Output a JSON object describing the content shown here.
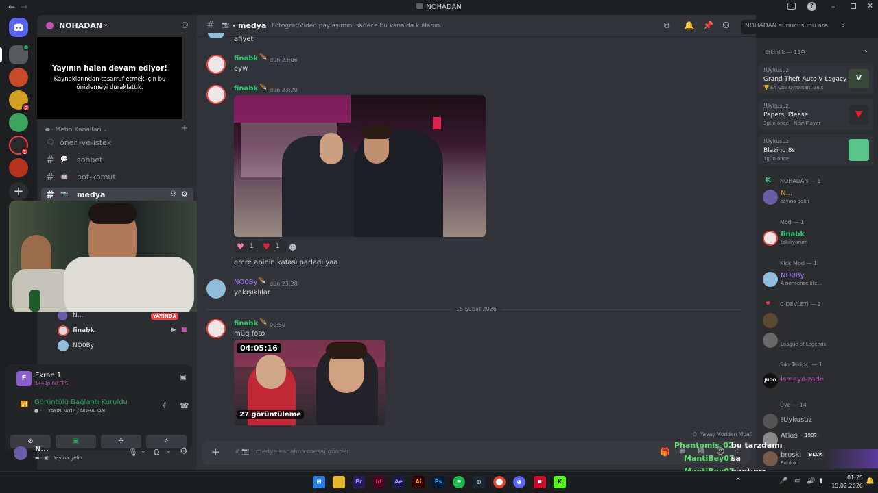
{
  "window": {
    "title": "NOHADAN"
  },
  "server": {
    "name": "NOHADAN",
    "badges": [
      "2",
      "1"
    ]
  },
  "stream_notice": {
    "title": "Yayının halen devam ediyor!",
    "body": "Kaynaklarından tasarruf etmek için bu önizlemeyi duraklattık."
  },
  "category": {
    "label": "Metin Kanalları"
  },
  "channels": [
    {
      "name": "öneri-ve-istek"
    },
    {
      "name": "sohbet"
    },
    {
      "name": "bot-komut"
    },
    {
      "name": "medya"
    }
  ],
  "voice_users": [
    {
      "name": "N...",
      "badge": "YAYINDA"
    },
    {
      "name": "finabk"
    },
    {
      "name": "NO0By"
    }
  ],
  "screen_panel": {
    "title": "Ekran 1",
    "sub": "1440p 60 FPS",
    "status": "Görüntülü Bağlantı Kuruldu",
    "channel": "YAYINDAYIZ / NOHADAN"
  },
  "user": {
    "name": "N...",
    "status": "Yayına gelin"
  },
  "chat_header": {
    "channel": "medya",
    "topic": "Fotoğraf/Video paylaşımını sadece bu kanalda kullanın.",
    "search_placeholder": "NOHADAN sunucusunu ara"
  },
  "messages": {
    "m0": {
      "text": "afiyet"
    },
    "m1": {
      "user": "finabk",
      "time": "dün 23:06",
      "text": "eyw"
    },
    "m2": {
      "user": "finabk",
      "time": "dün 23:20"
    },
    "reactions": [
      {
        "emoji": "♥",
        "count": "1"
      },
      {
        "emoji": "♥",
        "count": "1"
      }
    ],
    "m3": {
      "text": "emre abinin kafası parladı yaa"
    },
    "m4": {
      "user": "NO0By",
      "time": "dün 23:28",
      "text": "yakışıklılar"
    },
    "divider": "15 Şubat 2026",
    "m5": {
      "user": "finabk",
      "time": "00:50",
      "text": "müq foto",
      "video_time": "04:05:16",
      "video_views": "27 görüntüleme"
    }
  },
  "slowmode": "Yavaş Moddan Muaf",
  "composer": {
    "placeholder": "medya kanalına mesaj gönder"
  },
  "overlay_chat": [
    {
      "user": "Phantomis_02",
      "msg": "bu tarzdamı"
    },
    {
      "user": "MantiBey07",
      "msg": "sa"
    },
    {
      "user": "MantiBey07",
      "msg": "naptınız"
    }
  ],
  "activity": {
    "header": "Etkinlik — 15",
    "cards": [
      {
        "user": "!Uykusuz",
        "game": "Grand Theft Auto V Legacy",
        "meta": "En Çok Oynanan: 28 s"
      },
      {
        "user": "!Uykusuz",
        "game": "Papers, Please",
        "meta": "3gün önce",
        "meta2": "New Player"
      },
      {
        "user": "!Uykusuz",
        "game": "Blazing 8s",
        "meta": "1gün önce"
      }
    ]
  },
  "member_groups": [
    {
      "label": "NOHADAN — 1",
      "members": [
        {
          "name": "N...",
          "status": "Yayına gelin"
        }
      ]
    },
    {
      "label": "Mod — 1",
      "members": [
        {
          "name": "finabk",
          "status": "takılıyorum"
        }
      ]
    },
    {
      "label": "Kick Mod — 1",
      "members": [
        {
          "name": "NO0By",
          "status": "A nonsense life..."
        }
      ]
    },
    {
      "label": "C-DEVLETİ — 2",
      "members": [
        {
          "name": "...",
          "status": ""
        },
        {
          "name": ".",
          "status": "League of Legends"
        }
      ]
    },
    {
      "label": "Sıkı Takipçi — 1",
      "members": [
        {
          "name": "İsmayıl-zade",
          "status": ""
        }
      ]
    },
    {
      "label": "Üye — 14",
      "members": [
        {
          "name": "!Uykusuz",
          "status": ""
        },
        {
          "name": "Atlas",
          "status": "",
          "tag": "1907"
        },
        {
          "name": "broski",
          "status": "Roblox",
          "tag": "BLCK"
        }
      ]
    }
  ],
  "clock": {
    "time": "01:25",
    "date": "15.02.2026"
  },
  "colors": {
    "accent": "#5865f2",
    "green": "#23a55a",
    "red": "#f23f43",
    "mod_green": "#2dc770",
    "purple": "#a67eff"
  }
}
